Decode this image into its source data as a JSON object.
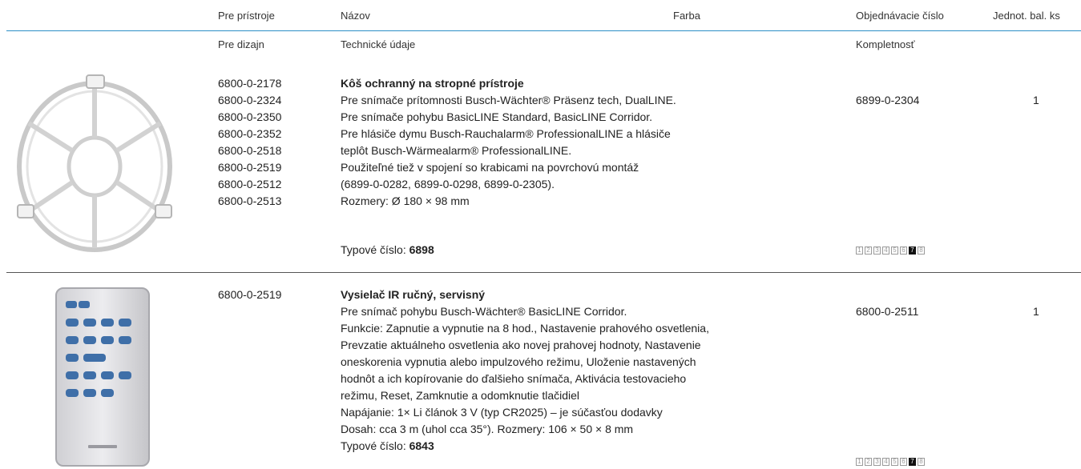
{
  "header": {
    "pre_pristroje": "Pre prístroje",
    "nazov": "Názov",
    "farba": "Farba",
    "objednavacie": "Objednávacie číslo",
    "jednot": "Jednot. bal. ks",
    "pre_dizajn": "Pre dizajn",
    "technicke": "Technické údaje",
    "kompletnost": "Kompletnosť"
  },
  "products": [
    {
      "image_icon": "protective-cage-icon",
      "devices": [
        "6800-0-2178",
        "6800-0-2324",
        "6800-0-2350",
        "6800-0-2352",
        "6800-0-2518",
        "6800-0-2519",
        "6800-0-2512",
        "6800-0-2513"
      ],
      "title": "Kôš ochranný na stropné prístroje",
      "lines": [
        "Pre snímače prítomnosti Busch-Wächter® Präsenz tech, DualLINE.",
        "Pre snímače pohybu BasicLINE Standard,  BasicLINE Corridor.",
        "Pre hlásiče dymu Busch-Rauchalarm® ProfessionalLINE a hlásiče",
        "teplôt Busch-Wärmealarm® ProfessionalLINE.",
        "Použiteľné tiež v spojení so krabicami na povrchovú montáž",
        "(6899-0-0282, 6899-0-0298, 6899-0-2305).",
        "Rozmery: Ø 180 × 98 mm"
      ],
      "type_label": "Typové číslo: ",
      "type_number": "6898",
      "order_number": "6899-0-2304",
      "qty": "1",
      "pages": [
        "1",
        "2",
        "3",
        "4",
        "5",
        "6",
        "7",
        "8"
      ],
      "active_page": "7"
    },
    {
      "image_icon": "ir-remote-control-icon",
      "devices": [
        "6800-0-2519"
      ],
      "title": "Vysielač IR ručný, servisný",
      "lines": [
        "Pre snímač pohybu Busch-Wächter® BasicLINE Corridor.",
        "Funkcie: Zapnutie a vypnutie na 8 hod., Nastavenie prahového osvetlenia,",
        "Prevzatie aktuálneho osvetlenia ako novej prahovej hodnoty, Nastavenie",
        "oneskorenia vypnutia alebo impulzového režimu, Uloženie nastavených",
        "hodnôt a ich kopírovanie do ďalšieho snímača, Aktivácia testovacieho",
        "režimu, Reset, Zamknutie a odomknutie tlačidiel",
        "Napájanie: 1× Li článok 3 V (typ CR2025) – je súčasťou dodavky",
        "Dosah: cca 3 m (uhol cca 35°). Rozmery: 106 × 50 × 8 mm"
      ],
      "type_label": "Typové číslo: ",
      "type_number": "6843",
      "order_number": "6800-0-2511",
      "qty": "1",
      "pages": [
        "1",
        "2",
        "3",
        "4",
        "5",
        "6",
        "7",
        "8"
      ],
      "active_page": "7"
    }
  ]
}
